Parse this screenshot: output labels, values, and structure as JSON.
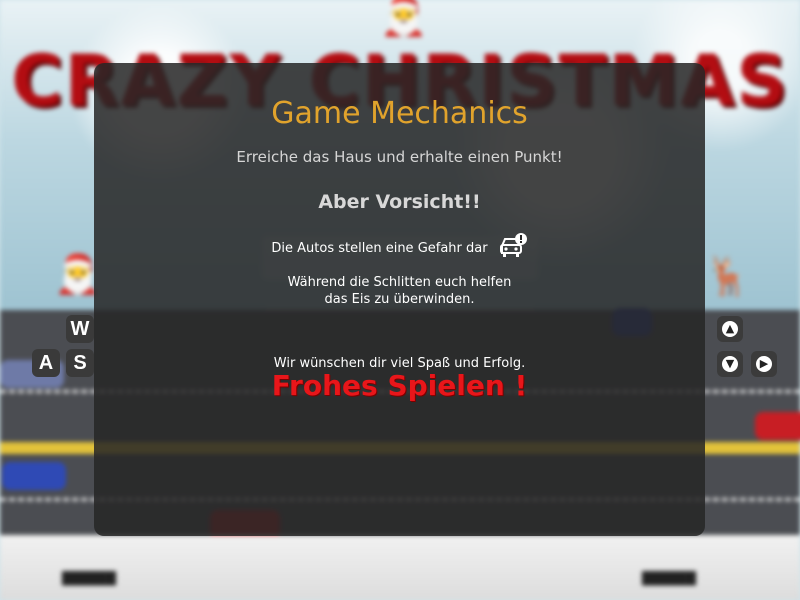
{
  "background": {
    "game_title": "CRAZY CHRISTMAS",
    "controls_left": {
      "up": "W",
      "left": "A",
      "down": "S"
    }
  },
  "dialog": {
    "title": "Game Mechanics",
    "goal": "Erreiche das Haus und erhalte einen Punkt!",
    "warning": "Aber Vorsicht!!",
    "cars_text": "Die Autos stellen eine Gefahr dar",
    "sleds_line1": "Während die Schlitten euch helfen",
    "sleds_line2": "das Eis zu überwinden.",
    "wish": "Wir wünschen dir viel Spaß und Erfolg.",
    "cta": "Frohes Spielen !"
  },
  "colors": {
    "title_accent": "#e1a32c",
    "cta_red": "#e8161a",
    "game_title_red": "#b30d12",
    "overlay": "#262626"
  },
  "icons": {
    "car_warning": "car-warning-icon",
    "arrow_up": "arrow-up-icon",
    "arrow_down": "arrow-down-icon",
    "arrow_right": "arrow-right-icon"
  }
}
